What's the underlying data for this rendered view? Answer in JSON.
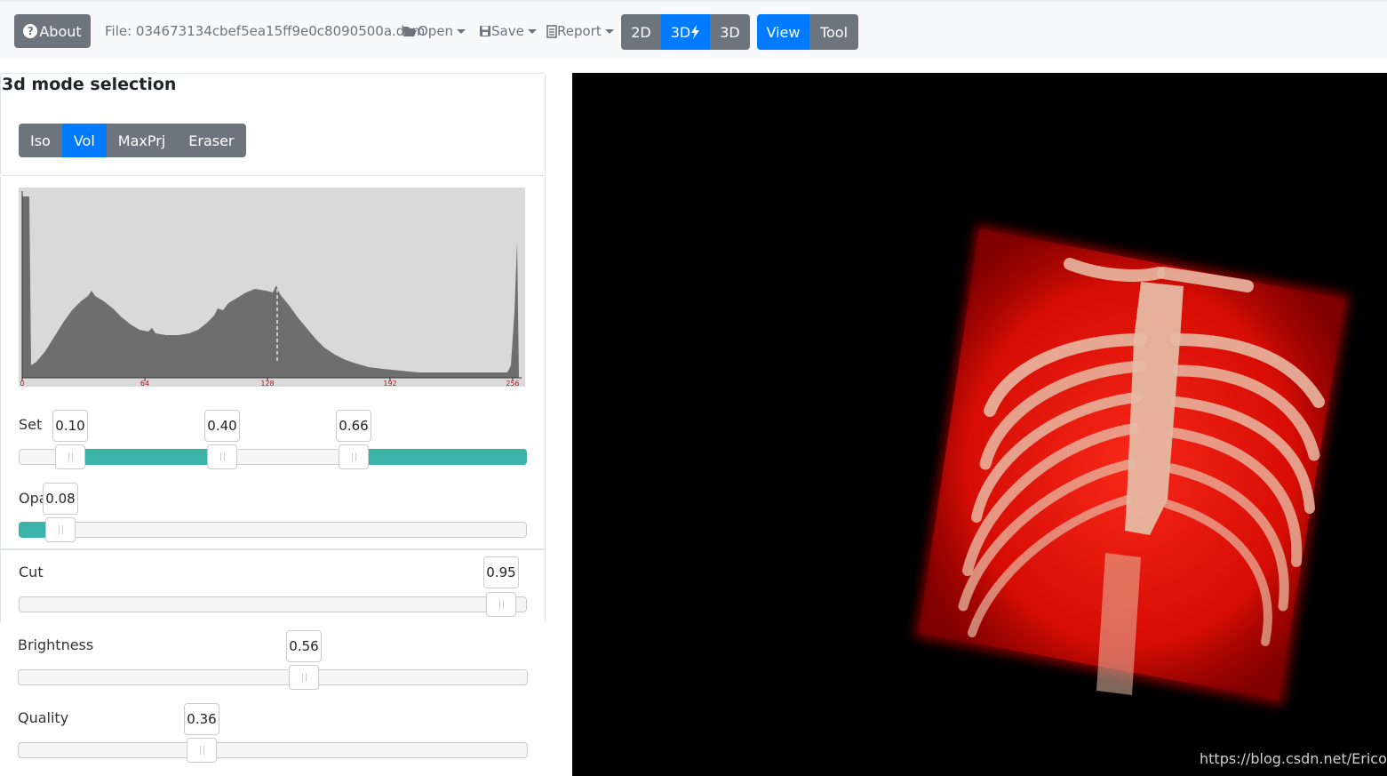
{
  "toolbar": {
    "about_label": "About",
    "file_label": "File: 034673134cbef5ea15ff9e0c8090500a.dcm",
    "open_label": "Open",
    "save_label": "Save",
    "report_label": "Report",
    "view_modes": [
      "2D",
      "3D",
      "3D"
    ],
    "view_mode_active": 1,
    "tools": [
      "View",
      "Tool"
    ],
    "tool_active": 0
  },
  "mode_panel": {
    "title": "3d mode selection",
    "modes": [
      "Iso",
      "Vol",
      "MaxPrj",
      "Eraser"
    ],
    "active": 1
  },
  "histogram": {
    "x_ticks": [
      "0",
      "64",
      "128",
      "192",
      "256"
    ],
    "fill_color": "#6e6e6e",
    "background_color": "#d9d9d9"
  },
  "controls": {
    "set": {
      "label": "Set",
      "values": [
        "0.10",
        "0.40",
        "0.66"
      ]
    },
    "opacity": {
      "label": "Opa",
      "value": "0.08"
    },
    "cut": {
      "label": "Cut",
      "value": "0.95"
    },
    "brightness": {
      "label": "Brightness",
      "value": "0.56"
    },
    "quality": {
      "label": "Quality",
      "value": "0.36"
    }
  },
  "colors": {
    "primary": "#007bff",
    "secondary": "#6c757d",
    "slider_fill": "#3bb3a9"
  },
  "watermark": "https://blog.csdn.net/Ericohe"
}
